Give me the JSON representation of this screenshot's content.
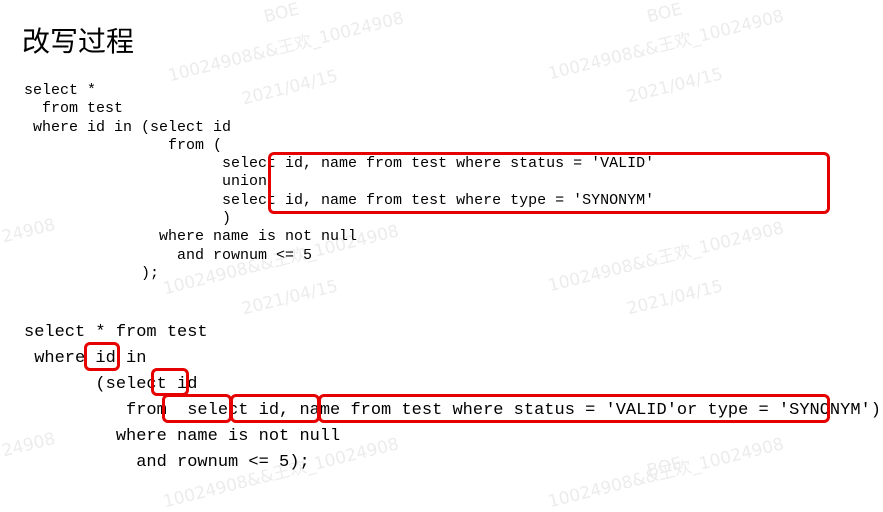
{
  "title": "改写过程",
  "watermark": {
    "name_line": "10024908&&王欢_10024908",
    "date_line": "2021/04/15",
    "short_line": "BOE",
    "partial_line": "24908"
  },
  "original_sql": [
    "select *",
    "  from test",
    " where id in (select id",
    "                from (",
    "                      select id, name from test where status = 'VALID'",
    "                      union",
    "                      select id, name from test where type = 'SYNONYM'",
    "                      )",
    "               where name is not null",
    "                 and rownum <= 5",
    "             );"
  ],
  "rewritten_sql": [
    "select * from test",
    " where id in",
    "       (select id",
    "          from  select id, name from test where status = 'VALID'or type = 'SYNONYM')",
    "         where name is not null",
    "           and rownum <= 5);"
  ],
  "highlight_color": "#e60000"
}
